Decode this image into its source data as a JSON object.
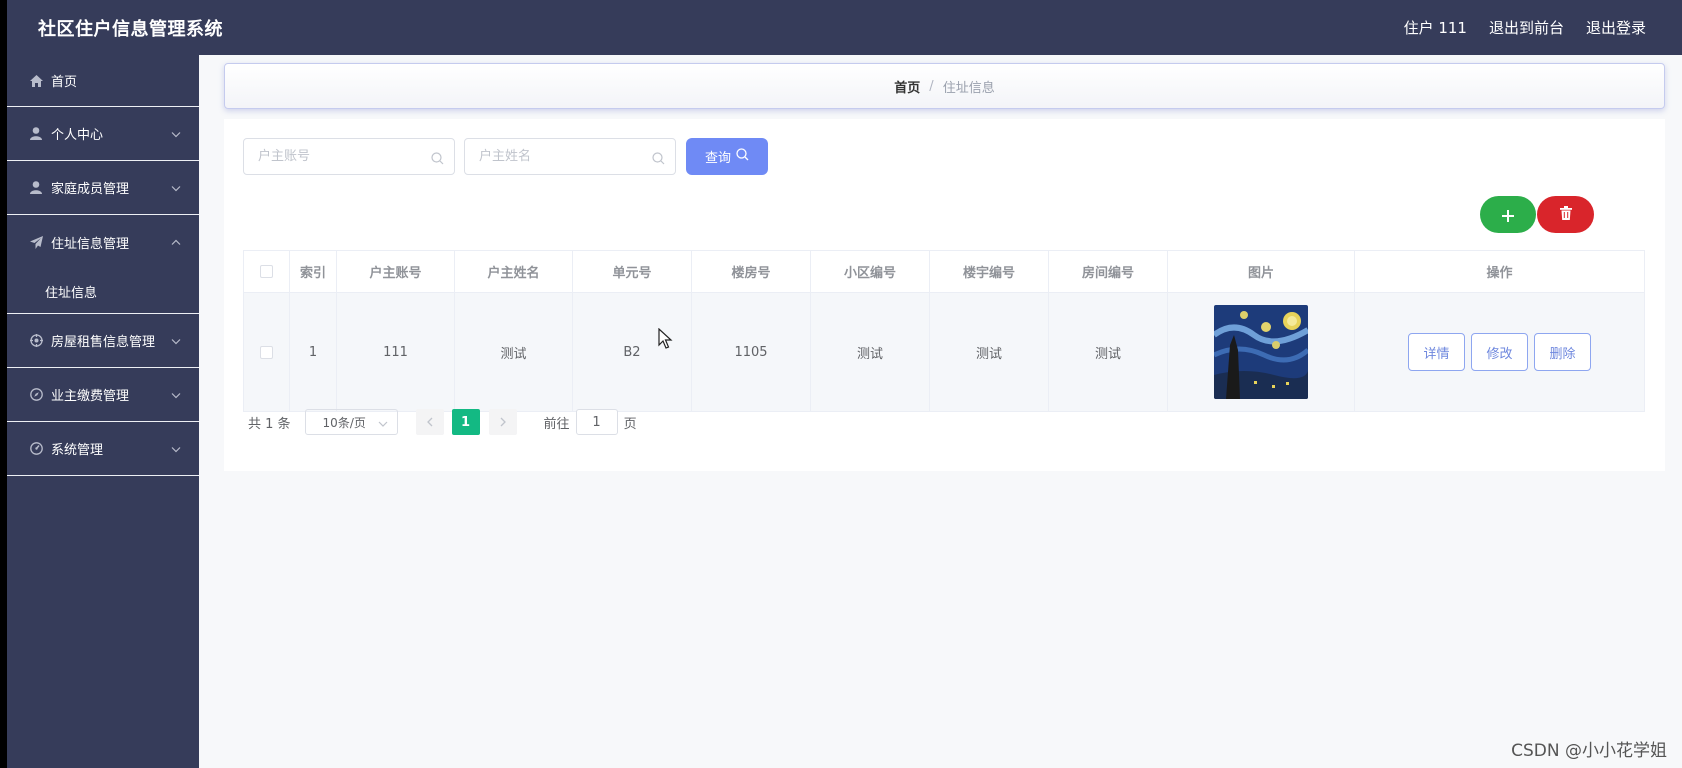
{
  "header": {
    "app_title": "社区住户信息管理系统",
    "user_label": "住户 111",
    "front_link": "退出到前台",
    "logout_link": "退出登录"
  },
  "sidebar": {
    "items": [
      {
        "label": "首页",
        "icon": "home-icon"
      },
      {
        "label": "个人中心",
        "icon": "user-icon"
      },
      {
        "label": "家庭成员管理",
        "icon": "user-icon"
      },
      {
        "label": "住址信息管理",
        "icon": "send-icon",
        "expanded": true,
        "children": [
          {
            "label": "住址信息"
          }
        ]
      },
      {
        "label": "房屋租售信息管理",
        "icon": "settings-icon"
      },
      {
        "label": "业主缴费管理",
        "icon": "compass-icon"
      },
      {
        "label": "系统管理",
        "icon": "gauge-icon"
      }
    ]
  },
  "breadcrumb": {
    "home": "首页",
    "separator": "/",
    "current": "住址信息"
  },
  "search": {
    "account_placeholder": "户主账号",
    "name_placeholder": "户主姓名",
    "query_label": "查询"
  },
  "table": {
    "headers": [
      "索引",
      "户主账号",
      "户主姓名",
      "单元号",
      "楼房号",
      "小区编号",
      "楼宇编号",
      "房间编号",
      "图片",
      "操作"
    ],
    "rows": [
      {
        "index": "1",
        "account": "111",
        "name": "测试",
        "unit": "B2",
        "building": "1105",
        "community_no": "测试",
        "building_no": "测试",
        "room_no": "测试",
        "image": "starry-night-thumbnail"
      }
    ],
    "actions": {
      "detail": "详情",
      "edit": "修改",
      "delete": "删除"
    }
  },
  "pagination": {
    "total_text": "共 1 条",
    "page_size": "10条/页",
    "current_page": "1",
    "goto_label": "前往",
    "goto_value": "1",
    "page_suffix": "页"
  },
  "colors": {
    "header_bg": "#363c5a",
    "primary": "#6f8af5",
    "add": "#2cae4a",
    "delete": "#d9252b",
    "page_active": "#13b983"
  },
  "watermark": "CSDN @小小花学姐"
}
